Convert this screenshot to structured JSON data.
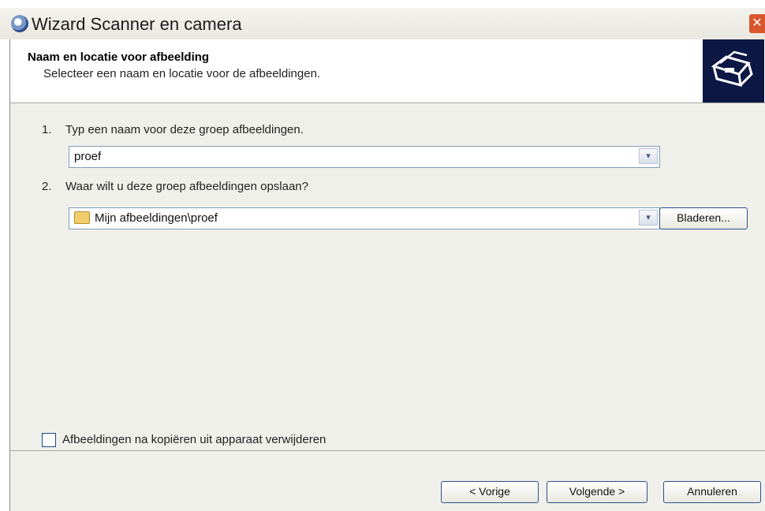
{
  "window": {
    "title": "Wizard Scanner en camera",
    "close_label": "✕"
  },
  "header": {
    "title": "Naam en locatie voor afbeelding",
    "subtitle": "Selecteer een naam en locatie voor de afbeeldingen."
  },
  "step1": {
    "number": "1.",
    "question": "Typ een naam voor deze groep afbeeldingen.",
    "value": "proef"
  },
  "step2": {
    "number": "2.",
    "question": "Waar wilt u deze groep afbeeldingen opslaan?",
    "value": "Mijn afbeeldingen\\proef",
    "browse_label": "Bladeren..."
  },
  "delete_option": {
    "label": "Afbeeldingen na kopiëren uit apparaat verwijderen",
    "checked": false
  },
  "buttons": {
    "back": "< Vorige",
    "next": "Volgende >",
    "cancel": "Annuleren"
  },
  "icons": {
    "dropdown": "▾"
  }
}
